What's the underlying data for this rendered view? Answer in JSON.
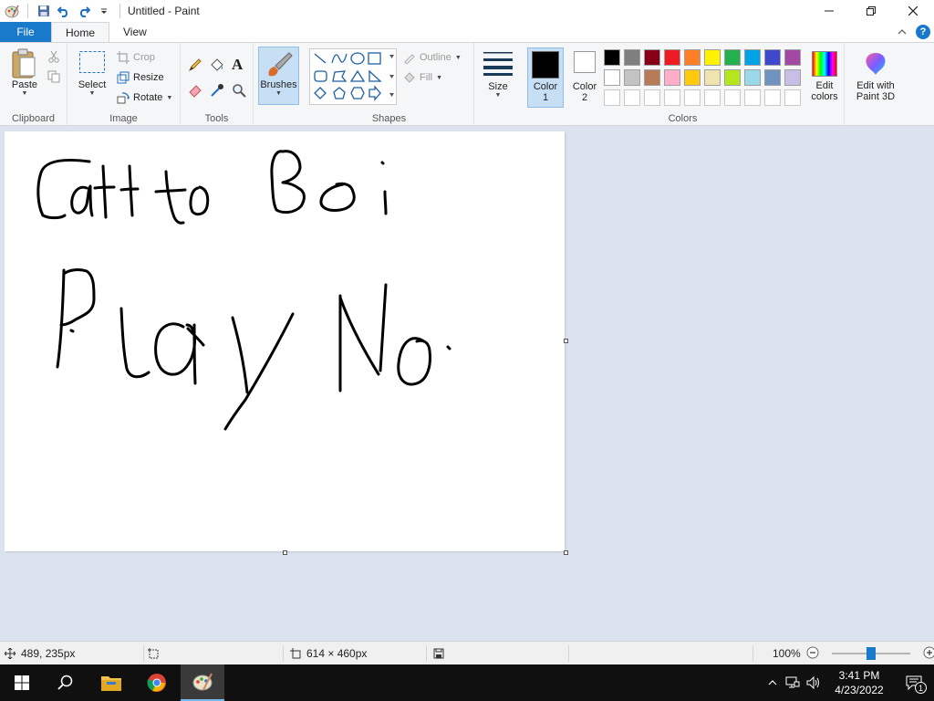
{
  "window": {
    "title": "Untitled - Paint"
  },
  "ribbon_tabs": [
    {
      "label": "File"
    },
    {
      "label": "Home"
    },
    {
      "label": "View"
    }
  ],
  "clipboard": {
    "paste_label": "Paste",
    "group_label": "Clipboard"
  },
  "image": {
    "select_label": "Select",
    "crop_label": "Crop",
    "resize_label": "Resize",
    "rotate_label": "Rotate",
    "group_label": "Image"
  },
  "tools": {
    "group_label": "Tools",
    "text_tool_glyph": "A"
  },
  "brushes": {
    "label": "Brushes"
  },
  "shapes": {
    "outline_label": "Outline",
    "fill_label": "Fill",
    "group_label": "Shapes"
  },
  "size": {
    "label": "Size"
  },
  "colors": {
    "color1_label": "Color",
    "color1_num": "1",
    "color2_label": "Color",
    "color2_num": "2",
    "color1_value": "#000000",
    "color2_value": "#ffffff",
    "group_label": "Colors",
    "edit_colors_line1": "Edit",
    "edit_colors_line2": "colors",
    "paint3d_line1": "Edit with",
    "paint3d_line2": "Paint 3D",
    "palette_row1": [
      "#000000",
      "#7f7f7f",
      "#880015",
      "#ed1c24",
      "#ff7f27",
      "#fff200",
      "#22b14c",
      "#00a2e8",
      "#3f48cc",
      "#a349a4"
    ],
    "palette_row2": [
      "#ffffff",
      "#c3c3c3",
      "#b97a57",
      "#ffaec9",
      "#ffc90e",
      "#efe4b0",
      "#b5e61d",
      "#99d9ea",
      "#7092be",
      "#c8bfe7"
    ]
  },
  "statusbar": {
    "cursor_position": "489, 235px",
    "canvas_size": "614 × 460px",
    "zoom": "100%",
    "zoom_level": 0.5
  },
  "taskbar": {
    "time": "3:41 PM",
    "date": "4/23/2022",
    "notification_count": "1"
  },
  "drawing": {
    "stroke_color": "#000000"
  }
}
